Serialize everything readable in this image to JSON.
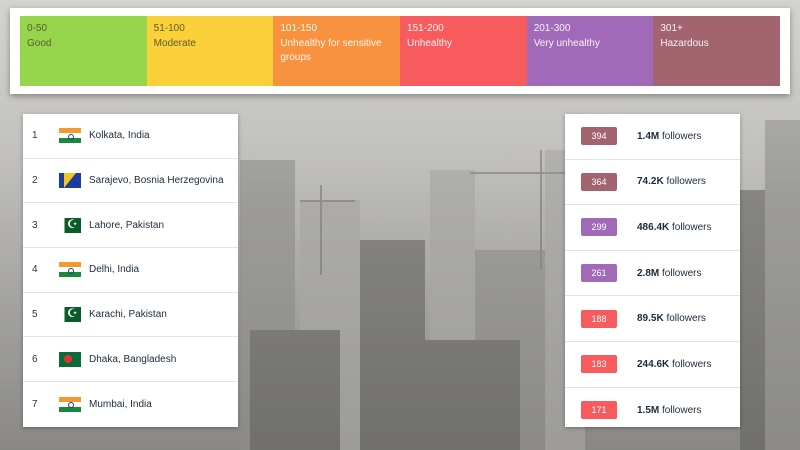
{
  "legend": [
    {
      "range": "0-50",
      "label": "Good",
      "color": "#97d54d",
      "dark": true
    },
    {
      "range": "51-100",
      "label": "Moderate",
      "color": "#fad13a",
      "dark": true
    },
    {
      "range": "101-150",
      "label": "Unhealthy for sensitive groups",
      "color": "#f9923e",
      "dark": false
    },
    {
      "range": "151-200",
      "label": "Unhealthy",
      "color": "#f75b5e",
      "dark": false
    },
    {
      "range": "201-300",
      "label": "Very unhealthy",
      "color": "#a06ab8",
      "dark": false
    },
    {
      "range": "301+",
      "label": "Hazardous",
      "color": "#a2646f",
      "dark": false
    }
  ],
  "cities": [
    {
      "rank": "1",
      "name": "Kolkata, India",
      "flag": "india-flag-icon",
      "flagClass": "flag-india"
    },
    {
      "rank": "2",
      "name": "Sarajevo, Bosnia Herzegovina",
      "flag": "bosnia-flag-icon",
      "flagClass": "flag-bih"
    },
    {
      "rank": "3",
      "name": "Lahore, Pakistan",
      "flag": "pakistan-flag-icon",
      "flagClass": "flag-pak"
    },
    {
      "rank": "4",
      "name": "Delhi, India",
      "flag": "india-flag-icon",
      "flagClass": "flag-india"
    },
    {
      "rank": "5",
      "name": "Karachi, Pakistan",
      "flag": "pakistan-flag-icon",
      "flagClass": "flag-pak"
    },
    {
      "rank": "6",
      "name": "Dhaka, Bangladesh",
      "flag": "bangladesh-flag-icon",
      "flagClass": "flag-bd"
    },
    {
      "rank": "7",
      "name": "Mumbai, India",
      "flag": "india-flag-icon",
      "flagClass": "flag-india"
    }
  ],
  "stats": [
    {
      "aqi": "394",
      "count": "1.4M",
      "suffix": " followers",
      "color": "#a2646f"
    },
    {
      "aqi": "364",
      "count": "74.2K",
      "suffix": " followers",
      "color": "#a2646f"
    },
    {
      "aqi": "299",
      "count": "486.4K",
      "suffix": " followers",
      "color": "#a06ab8"
    },
    {
      "aqi": "261",
      "count": "2.8M",
      "suffix": " followers",
      "color": "#a06ab8"
    },
    {
      "aqi": "188",
      "count": "89.5K",
      "suffix": " followers",
      "color": "#f75b5e"
    },
    {
      "aqi": "183",
      "count": "244.6K",
      "suffix": " followers",
      "color": "#f75b5e"
    },
    {
      "aqi": "171",
      "count": "1.5M",
      "suffix": " followers",
      "color": "#f75b5e"
    }
  ]
}
